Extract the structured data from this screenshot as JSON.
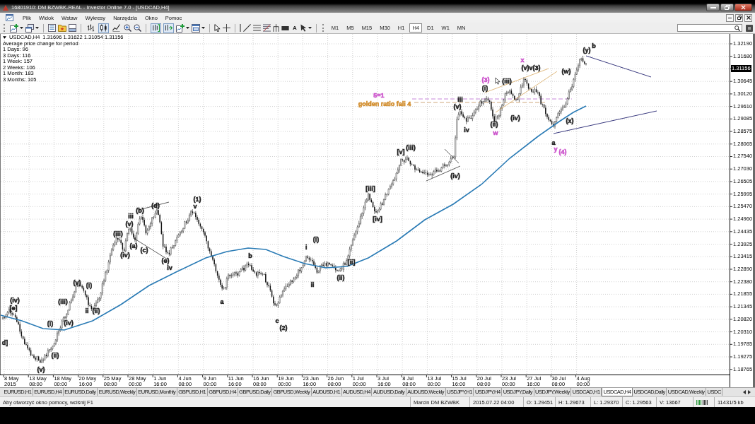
{
  "window": {
    "title": "16801910: DM BZWBK-REAL - Investor Online 7.0 - [USDCAD,H4]"
  },
  "menu": [
    "Plik",
    "Widok",
    "Wstaw",
    "Wykresy",
    "Narzędzia",
    "Okno",
    "Pomoc"
  ],
  "toolbar": {
    "chart_types": [
      {
        "kind": "bars",
        "selected": false
      },
      {
        "kind": "candles",
        "selected": true
      },
      {
        "kind": "line",
        "selected": false
      }
    ],
    "chart_options": [
      {
        "kind": "shift",
        "on": true
      },
      {
        "kind": "autoscroll",
        "on": true
      }
    ],
    "text_tool": "A",
    "timeframes": [
      {
        "label": "M1",
        "selected": false
      },
      {
        "label": "M5",
        "selected": false
      },
      {
        "label": "M15",
        "selected": false
      },
      {
        "label": "M30",
        "selected": false
      },
      {
        "label": "H1",
        "selected": false
      },
      {
        "label": "H4",
        "selected": true
      },
      {
        "label": "D1",
        "selected": false
      },
      {
        "label": "W1",
        "selected": false
      },
      {
        "label": "MN",
        "selected": false
      }
    ]
  },
  "chart": {
    "symbol": "USDCAD,H4",
    "quote": "1.31696 1.31622 1.31054 1.31156",
    "stats_title": "Average price change for period",
    "stats": [
      "1 Days: 96",
      "3 Days: 116",
      "1 Week: 157",
      "2 Weeks: 106",
      "1 Month: 183",
      "3 Months: 105"
    ],
    "wave_labels": [
      {
        "text": "(iv)",
        "color": "#222222"
      },
      {
        "text": "[e]",
        "color": "#222222"
      },
      {
        "text": "d]",
        "color": "#222222"
      },
      {
        "text": "(i)",
        "color": "#222222"
      },
      {
        "text": "(ii)",
        "color": "#222222"
      },
      {
        "text": "(v)",
        "color": "#222222"
      },
      {
        "text": "(iii)",
        "color": "#222222"
      },
      {
        "text": "(iv)",
        "color": "#222222"
      },
      {
        "text": "(v)",
        "color": "#222222"
      },
      {
        "text": "(i)",
        "color": "#222222"
      },
      {
        "text": "ii",
        "color": "#222222"
      },
      {
        "text": "(ii)",
        "color": "#222222"
      },
      {
        "text": "(iii)",
        "color": "#222222"
      },
      {
        "text": "iii",
        "color": "#222222"
      },
      {
        "text": "(v)",
        "color": "#222222"
      },
      {
        "text": "(iv)",
        "color": "#222222"
      },
      {
        "text": "(a)",
        "color": "#222222"
      },
      {
        "text": "(b)",
        "color": "#222222"
      },
      {
        "text": "(c)",
        "color": "#222222"
      },
      {
        "text": "(d)",
        "color": "#222222"
      },
      {
        "text": "(e)",
        "color": "#222222"
      },
      {
        "text": "iv",
        "color": "#222222"
      },
      {
        "text": "(1)",
        "color": "#222222"
      },
      {
        "text": "v",
        "color": "#222222"
      },
      {
        "text": "a",
        "color": "#222222"
      },
      {
        "text": "b",
        "color": "#222222"
      },
      {
        "text": "c",
        "color": "#222222"
      },
      {
        "text": "(2)",
        "color": "#222222"
      },
      {
        "text": "i",
        "color": "#222222"
      },
      {
        "text": "(i)",
        "color": "#222222"
      },
      {
        "text": "ii",
        "color": "#222222"
      },
      {
        "text": "(ii)",
        "color": "#222222"
      },
      {
        "text": "[ii]",
        "color": "#222222"
      },
      {
        "text": "[iii]",
        "color": "#222222"
      },
      {
        "text": "[iv]",
        "color": "#222222"
      },
      {
        "text": "[v]",
        "color": "#222222"
      },
      {
        "text": "(iii)",
        "color": "#222222"
      },
      {
        "text": "(iv)",
        "color": "#222222"
      },
      {
        "text": "5=1",
        "color": "#cc55cc"
      },
      {
        "text": "golden ratio fali 4",
        "color": "#d08a28"
      },
      {
        "text": "iii",
        "color": "#222222"
      },
      {
        "text": "(v)",
        "color": "#222222"
      },
      {
        "text": "iv",
        "color": "#222222"
      },
      {
        "text": "(3)",
        "color": "#cc55cc"
      },
      {
        "text": "(i)",
        "color": "#222222"
      },
      {
        "text": "(iii)",
        "color": "#222222"
      },
      {
        "text": "(ii)",
        "color": "#222222"
      },
      {
        "text": "w",
        "color": "#cc55cc"
      },
      {
        "text": "(iv)",
        "color": "#222222"
      },
      {
        "text": "x",
        "color": "#cc55cc"
      },
      {
        "text": "(v)v(3)",
        "color": "#222222"
      },
      {
        "text": "(w)",
        "color": "#222222"
      },
      {
        "text": "(y)",
        "color": "#222222"
      },
      {
        "text": "b",
        "color": "#222222"
      },
      {
        "text": "(x)",
        "color": "#222222"
      },
      {
        "text": "a",
        "color": "#222222"
      },
      {
        "text": "y",
        "color": "#cc55cc"
      },
      {
        "text": "(4)",
        "color": "#cc55cc"
      }
    ],
    "price_axis": [
      {
        "label": "1.32190",
        "current": false
      },
      {
        "label": "1.31680",
        "current": false
      },
      {
        "label": "1.31156",
        "current": true
      },
      {
        "label": "1.30645",
        "current": false
      },
      {
        "label": "1.30120",
        "current": false
      },
      {
        "label": "1.29610",
        "current": false
      },
      {
        "label": "1.29085",
        "current": false
      },
      {
        "label": "1.28575",
        "current": false
      },
      {
        "label": "1.28065",
        "current": false
      },
      {
        "label": "1.27540",
        "current": false
      },
      {
        "label": "1.27030",
        "current": false
      },
      {
        "label": "1.26505",
        "current": false
      },
      {
        "label": "1.25995",
        "current": false
      },
      {
        "label": "1.25470",
        "current": false
      },
      {
        "label": "1.24960",
        "current": false
      },
      {
        "label": "1.24435",
        "current": false
      },
      {
        "label": "1.23925",
        "current": false
      },
      {
        "label": "1.23415",
        "current": false
      },
      {
        "label": "1.22890",
        "current": false
      },
      {
        "label": "1.22380",
        "current": false
      },
      {
        "label": "1.21855",
        "current": false
      },
      {
        "label": "1.21345",
        "current": false
      },
      {
        "label": "1.20820",
        "current": false
      },
      {
        "label": "1.20310",
        "current": false
      },
      {
        "label": "1.19785",
        "current": false
      },
      {
        "label": "1.19275",
        "current": false
      },
      {
        "label": "1.18765",
        "current": false
      }
    ],
    "time_axis": [
      "8 May 2015",
      "13 May 08:00",
      "18 May 00:00",
      "20 May 16:00",
      "25 May 08:00",
      "28 May 00:00",
      "1 Jun 16:00",
      "4 Jun 08:00",
      "9 Jun 00:00",
      "11 Jun 16:00",
      "16 Jun 08:00",
      "19 Jun 00:00",
      "23 Jun 16:00",
      "26 Jun 08:00",
      "1 Jul 00:00",
      "3 Jul 16:00",
      "8 Jul 08:00",
      "13 Jul 00:00",
      "15 Jul 16:00",
      "20 Jul 08:00",
      "23 Jul 00:00",
      "27 Jul 16:00",
      "30 Jul 08:00",
      "4 Aug 00:00"
    ]
  },
  "tabs": [
    {
      "label": "EURUSD,H1",
      "selected": false
    },
    {
      "label": "EURUSD,H4",
      "selected": false
    },
    {
      "label": "EURUSD,Daily",
      "selected": false
    },
    {
      "label": "EURUSD,Weekly",
      "selected": false
    },
    {
      "label": "EURUSD,Monthly",
      "selected": false
    },
    {
      "label": "GBPUSD,H1",
      "selected": false
    },
    {
      "label": "GBPUSD,H4",
      "selected": false
    },
    {
      "label": "GBPUSD,Daily",
      "selected": false
    },
    {
      "label": "GBPUSD,Weekly",
      "selected": false
    },
    {
      "label": "AUDUSD,H1",
      "selected": false
    },
    {
      "label": "AUDUSD,H4",
      "selected": false
    },
    {
      "label": "AUDUSD,Daily",
      "selected": false
    },
    {
      "label": "AUDUSD,Weekly",
      "selected": false
    },
    {
      "label": "USDJPY,H1",
      "selected": false
    },
    {
      "label": "USDJPY,H4",
      "selected": false
    },
    {
      "label": "USDJPY,Daily",
      "selected": false
    },
    {
      "label": "USDJPY,Weekly",
      "selected": false
    },
    {
      "label": "USDCAD,H1",
      "selected": false
    },
    {
      "label": "USDCAD,H4",
      "selected": true
    },
    {
      "label": "USDCAD,Daily",
      "selected": false
    },
    {
      "label": "USDCAD,Weekly",
      "selected": false
    },
    {
      "label": "USDC",
      "selected": false
    }
  ],
  "status_bar": {
    "help": "Aby otworzyć okno pomocy, wciśnij F1",
    "account": "Marcin DM BZWBK",
    "time": "2015.07.22 04:00",
    "open": "O: 1.29451",
    "high": "H: 1.29673",
    "low": "L: 1.29370",
    "close": "C: 1.29563",
    "volume": "V: 13667",
    "traffic": "11431/5 kb"
  }
}
